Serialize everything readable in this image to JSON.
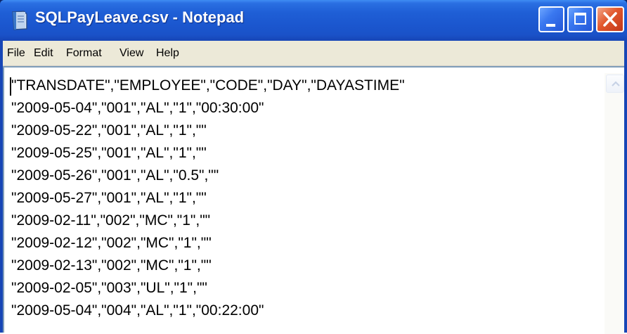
{
  "window": {
    "title": "SQLPayLeave.csv - Notepad"
  },
  "titlebar_buttons": {
    "minimize_icon": "minimize-icon",
    "maximize_icon": "maximize-icon",
    "close_icon": "close-icon"
  },
  "menu": {
    "file": "File",
    "edit": "Edit",
    "format": "Format",
    "view": "View",
    "help": "Help"
  },
  "document": {
    "lines": [
      "\"TRANSDATE\",\"EMPLOYEE\",\"CODE\",\"DAY\",\"DAYASTIME\"",
      "\"2009-05-04\",\"001\",\"AL\",\"1\",\"00:30:00\"",
      "\"2009-05-22\",\"001\",\"AL\",\"1\",\"\"",
      "\"2009-05-25\",\"001\",\"AL\",\"1\",\"\"",
      "\"2009-05-26\",\"001\",\"AL\",\"0.5\",\"\"",
      "\"2009-05-27\",\"001\",\"AL\",\"1\",\"\"",
      "\"2009-02-11\",\"002\",\"MC\",\"1\",\"\"",
      "\"2009-02-12\",\"002\",\"MC\",\"1\",\"\"",
      "\"2009-02-13\",\"002\",\"MC\",\"1\",\"\"",
      "\"2009-02-05\",\"003\",\"UL\",\"1\",\"\"",
      "\"2009-05-04\",\"004\",\"AL\",\"1\",\"00:22:00\""
    ]
  },
  "colors": {
    "titlebar": "#1f5fd6",
    "close_button": "#e2582d",
    "menubar": "#ece9d8",
    "editor_background": "#ffffff"
  }
}
